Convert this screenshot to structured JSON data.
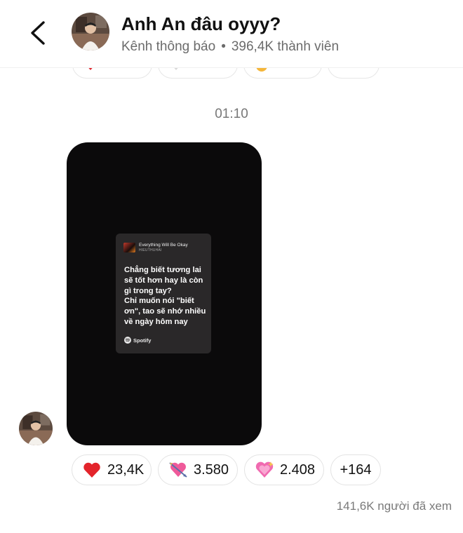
{
  "header": {
    "title": "Anh An đâu oyyy?",
    "channel_type": "Kênh thông báo",
    "separator": "•",
    "members": "396,4K thành viên"
  },
  "message": {
    "time": "01:10",
    "sticker": {
      "song": "Everything Will Be Okay",
      "artist": "HIEUTHUHAI",
      "lyrics": [
        "Chẳng biết tương lai",
        "sẽ tốt hơn hay là còn",
        "gì trong tay?",
        "Chỉ muốn nói \"biết",
        "ơn\", tao sẽ nhớ nhiều",
        "về ngày hôm nay"
      ],
      "brand": "Spotify"
    }
  },
  "reactions": [
    {
      "icon": "red-heart-icon",
      "count": "23,4K"
    },
    {
      "icon": "heart-with-arrow-icon",
      "count": "3.580"
    },
    {
      "icon": "sparkling-heart-icon",
      "count": "2.408"
    },
    {
      "icon": "",
      "count": "+164"
    }
  ],
  "views": "141,6K người đã xem",
  "colors": {
    "accent_spotify": "#1DB954",
    "card_bg": "#0b0a0b"
  }
}
